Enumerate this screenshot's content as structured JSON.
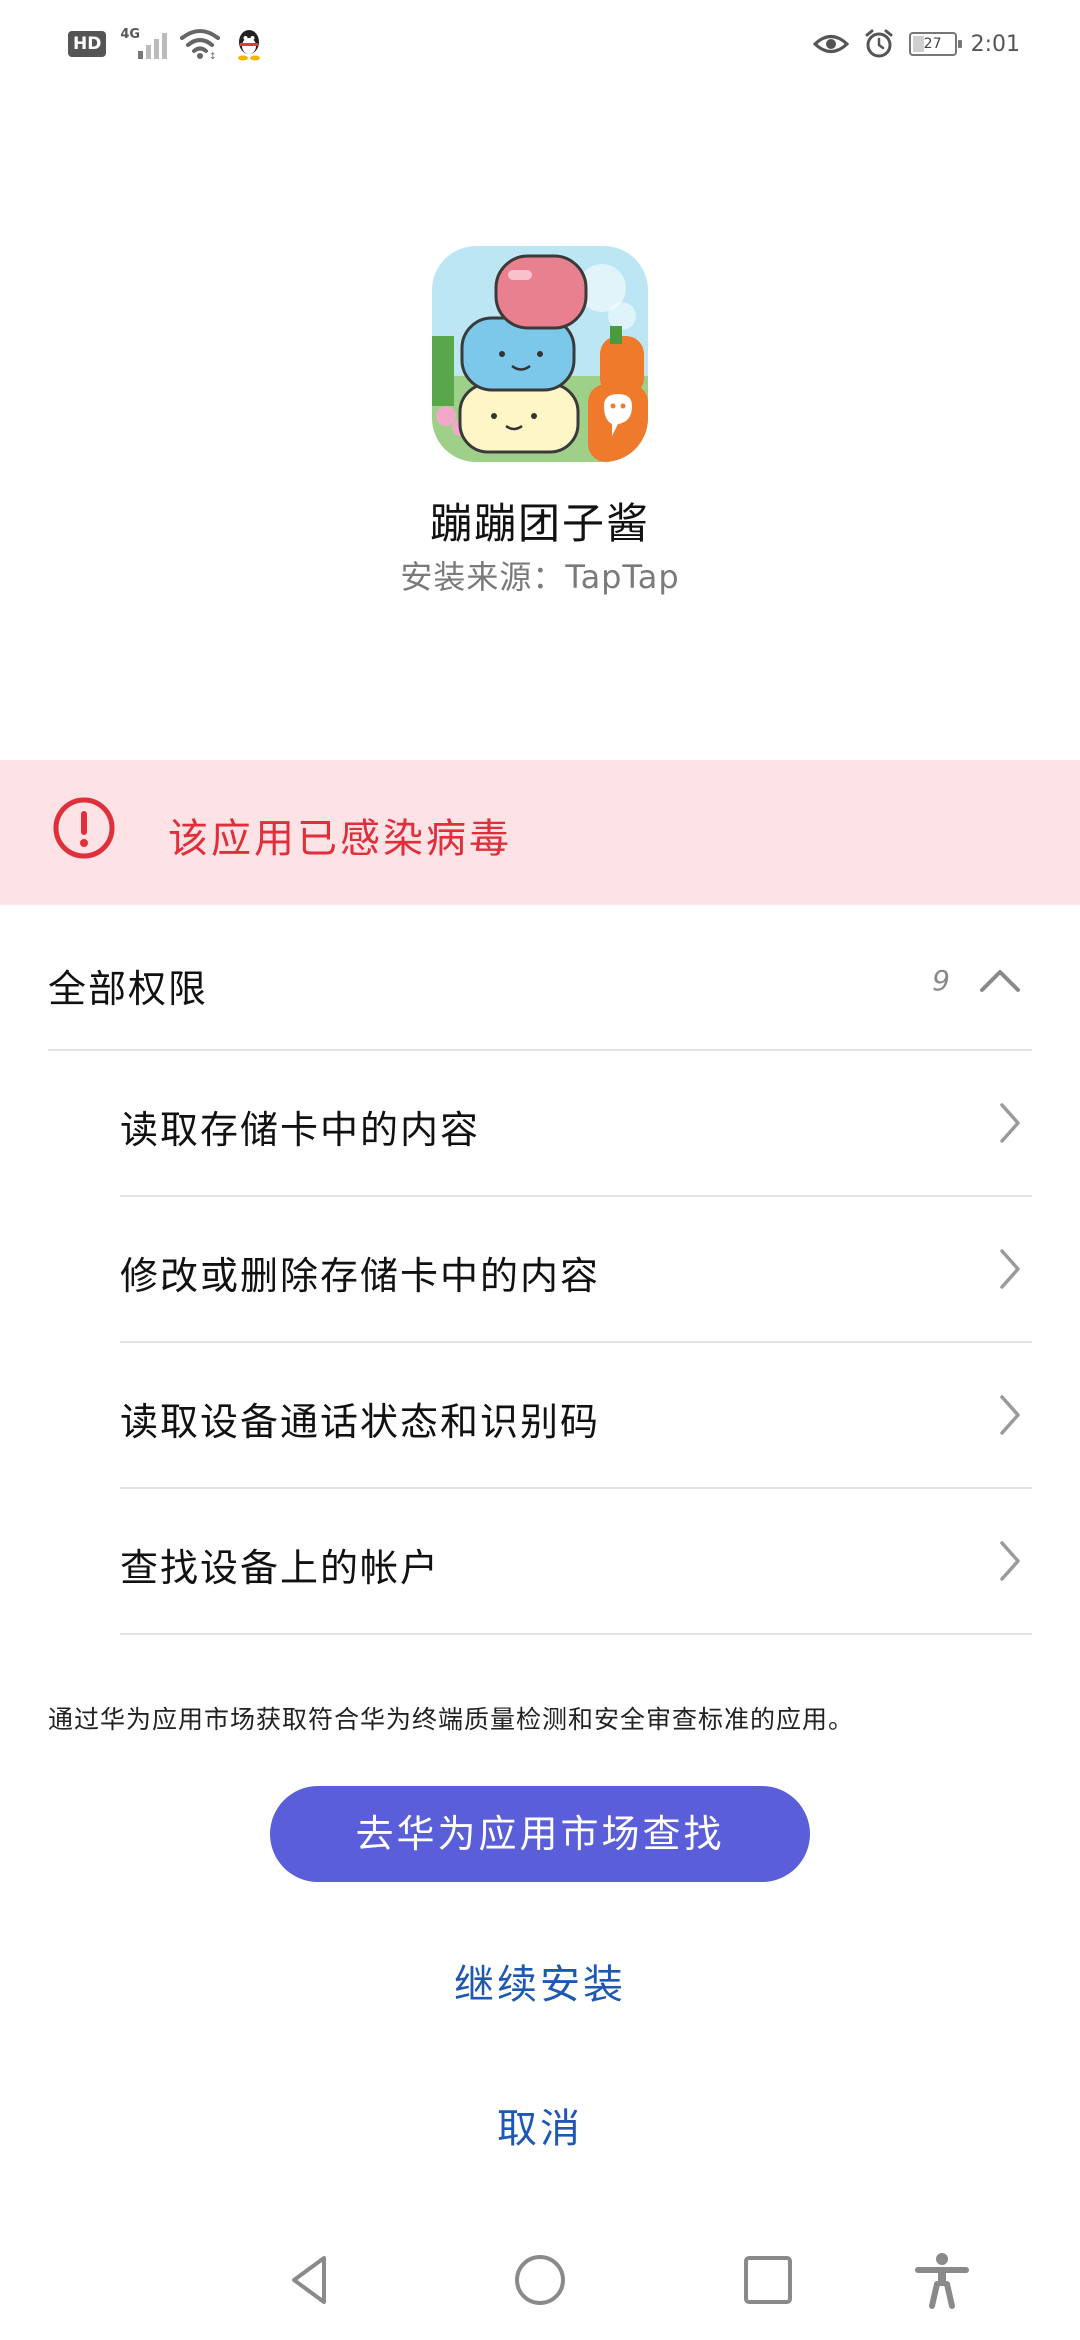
{
  "status_bar": {
    "hd_label": "HD",
    "network_label": "4G",
    "battery_level": "27",
    "time": "2:01"
  },
  "app": {
    "name": "蹦蹦团子酱",
    "source": "安装来源：TapTap"
  },
  "warning": {
    "text": "该应用已感染病毒",
    "color": "#e02e3a",
    "background": "#fde3e5"
  },
  "permissions": {
    "title": "全部权限",
    "count": "9",
    "items": [
      {
        "label": "读取存储卡中的内容"
      },
      {
        "label": "修改或删除存储卡中的内容"
      },
      {
        "label": "读取设备通话状态和识别码"
      },
      {
        "label": "查找设备上的帐户"
      }
    ]
  },
  "market": {
    "note": "通过华为应用市场获取符合华为终端质量检测和安全审查标准的应用。",
    "button_label": "去华为应用市场查找",
    "button_color": "#5a5fd9"
  },
  "actions": {
    "continue_label": "继续安装",
    "cancel_label": "取消",
    "link_color": "#1e58b5"
  },
  "nav": {
    "icons": [
      "back-icon",
      "home-icon",
      "recents-icon",
      "accessibility-icon"
    ]
  }
}
